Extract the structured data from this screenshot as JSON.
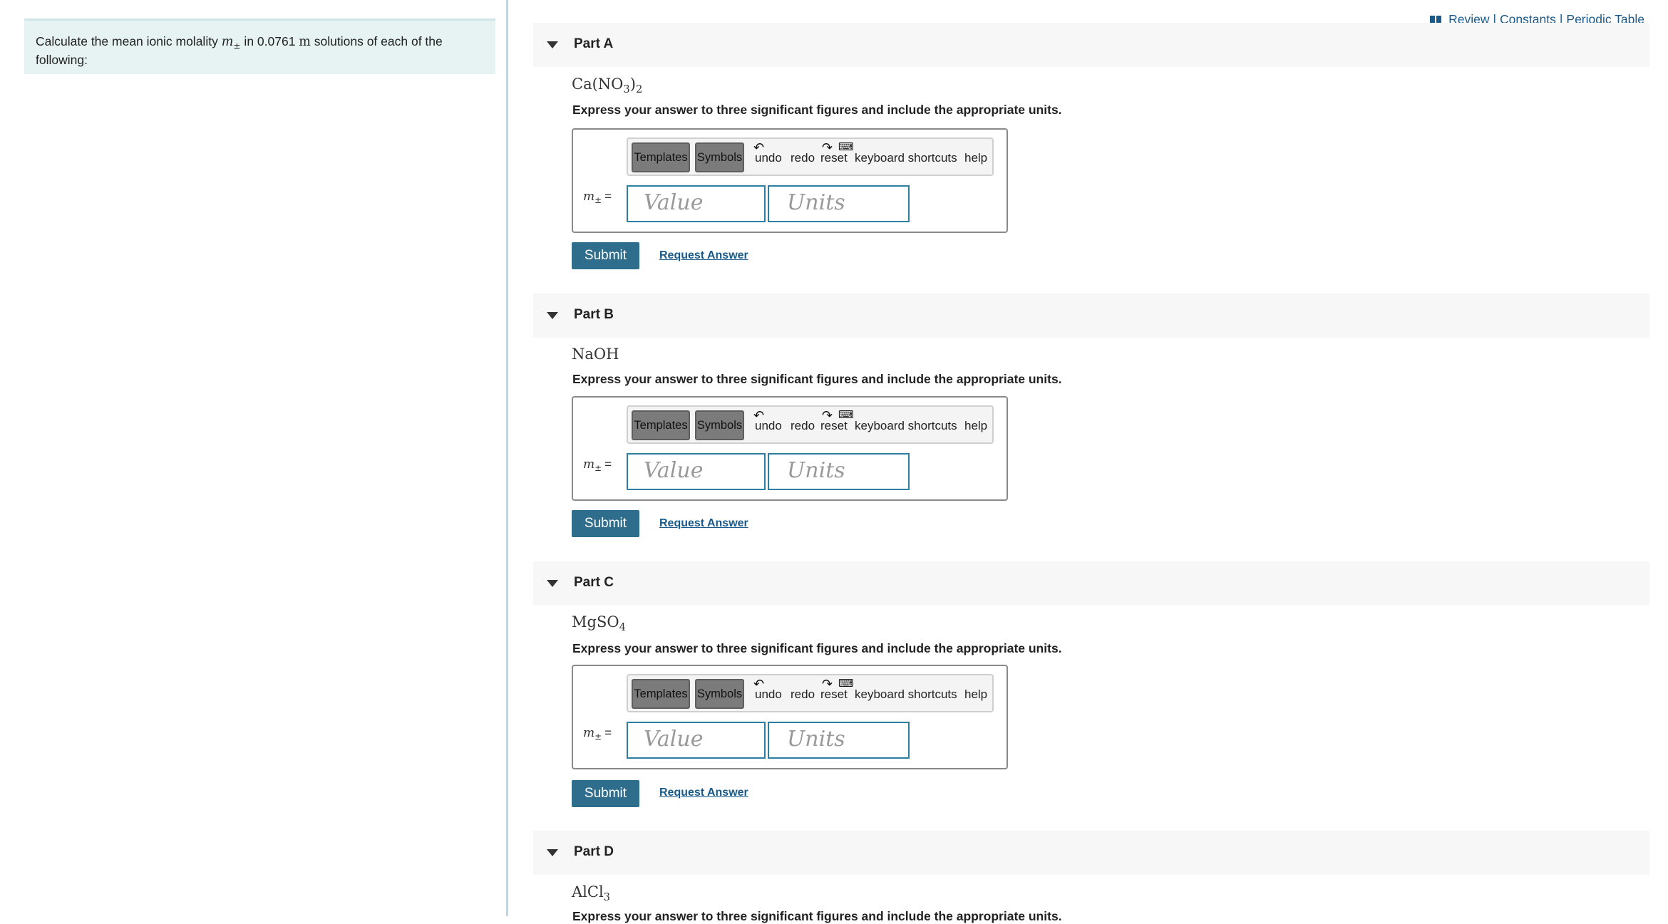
{
  "top_links": [
    "Review",
    "Constants",
    "Periodic Table"
  ],
  "top_links_sep": "|",
  "intro": {
    "text_before": "Calculate the mean ionic molality ",
    "var": "m",
    "var_sub": "±",
    "text_middle": " in 0.0761 ",
    "unit": "m",
    "text_after": " solutions of each of the following:"
  },
  "instruction": "Express your answer to three significant figures and include the appropriate units.",
  "toolbar": {
    "templates": "Templates",
    "symbols": "Symbols",
    "undo": "undo",
    "redo": "redo",
    "reset": "reset",
    "keyboard_shortcuts": "keyboard shortcuts",
    "help": "help"
  },
  "var_label": {
    "var": "m",
    "sub": "±",
    "eq": "="
  },
  "placeholders": {
    "value": "Value",
    "units": "Units"
  },
  "buttons": {
    "submit": "Submit",
    "request": "Request Answer"
  },
  "parts": [
    {
      "title": "Part A",
      "formula": {
        "base": "Ca(NO",
        "sub1": "3",
        "mid": ")",
        "sub2": "2"
      }
    },
    {
      "title": "Part B",
      "formula": {
        "base": "NaOH",
        "sub1": "",
        "mid": "",
        "sub2": ""
      }
    },
    {
      "title": "Part C",
      "formula": {
        "base": "MgSO",
        "sub1": "4",
        "mid": "",
        "sub2": ""
      }
    },
    {
      "title": "Part D",
      "formula": {
        "base": "AlCl",
        "sub1": "3",
        "mid": "",
        "sub2": ""
      }
    }
  ]
}
